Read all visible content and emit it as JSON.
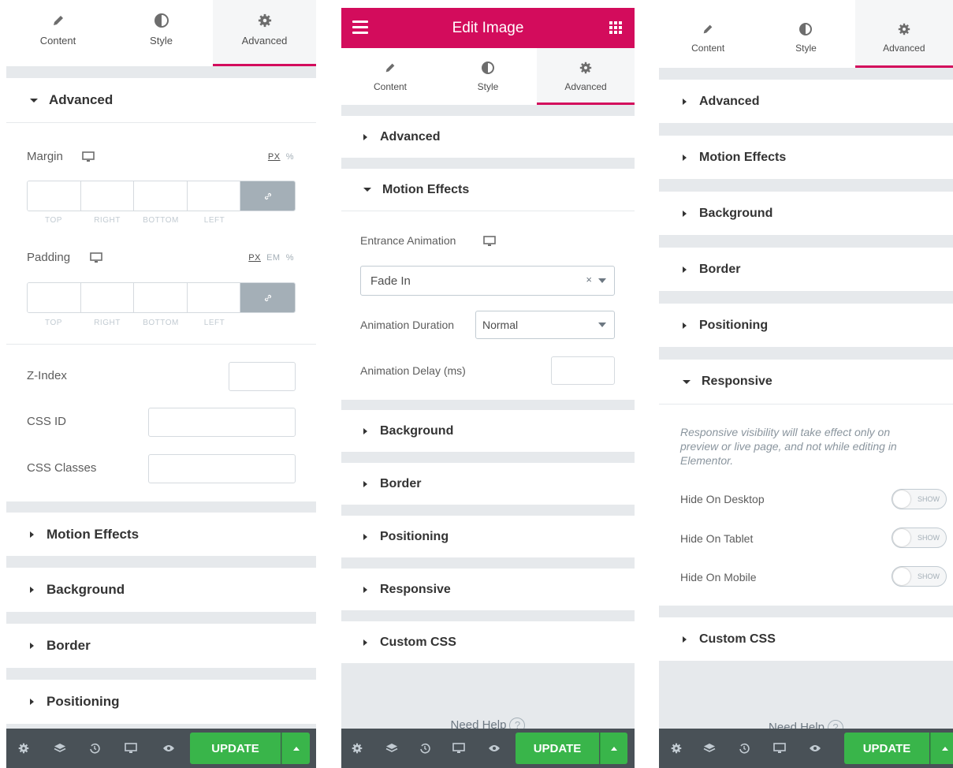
{
  "colors": {
    "brand": "#d30c5c",
    "update": "#39b54a",
    "footer": "#495157",
    "gray_bg": "#e6e9ec"
  },
  "tabs": [
    {
      "label": "Content",
      "icon": "pencil-icon"
    },
    {
      "label": "Style",
      "icon": "half-circle-icon"
    },
    {
      "label": "Advanced",
      "icon": "gear-icon",
      "active": true
    }
  ],
  "left": {
    "advanced_title": "Advanced",
    "margin_label": "Margin",
    "margin_units": {
      "px": "PX",
      "pct": "%"
    },
    "dim_labels": [
      "TOP",
      "RIGHT",
      "BOTTOM",
      "LEFT"
    ],
    "padding_label": "Padding",
    "padding_units": {
      "px": "PX",
      "em": "EM",
      "pct": "%"
    },
    "zindex_label": "Z-Index",
    "cssid_label": "CSS ID",
    "cssclasses_label": "CSS Classes",
    "sections": [
      "Motion Effects",
      "Background",
      "Border",
      "Positioning"
    ]
  },
  "middle": {
    "header_title": "Edit Image",
    "advanced_title": "Advanced",
    "motion_title": "Motion Effects",
    "entrance_label": "Entrance Animation",
    "entrance_value": "Fade In",
    "clear_symbol": "×",
    "duration_label": "Animation Duration",
    "duration_value": "Normal",
    "delay_label": "Animation Delay (ms)",
    "sections": [
      "Background",
      "Border",
      "Positioning",
      "Responsive",
      "Custom CSS"
    ],
    "need_help": "Need Help",
    "help_q": "?"
  },
  "right": {
    "sections_top": [
      "Advanced",
      "Motion Effects",
      "Background",
      "Border",
      "Positioning"
    ],
    "responsive_title": "Responsive",
    "responsive_note": "Responsive visibility will take effect only on preview or live page, and not while editing in Elementor.",
    "toggles": [
      {
        "label": "Hide On Desktop",
        "state": "SHOW"
      },
      {
        "label": "Hide On Tablet",
        "state": "SHOW"
      },
      {
        "label": "Hide On Mobile",
        "state": "SHOW"
      }
    ],
    "custom_css_title": "Custom CSS",
    "need_help": "Need Help",
    "help_q": "?"
  },
  "footer": {
    "update_label": "UPDATE",
    "icons": [
      "gear-icon",
      "layers-icon",
      "history-icon",
      "responsive-icon",
      "eye-icon"
    ]
  }
}
